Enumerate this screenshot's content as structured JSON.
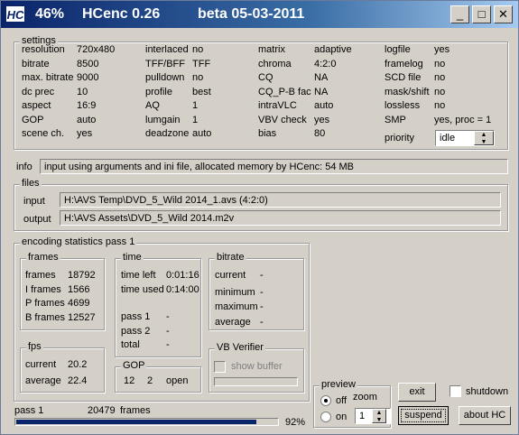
{
  "title": {
    "logo": "HC",
    "percent": "46%",
    "app": "HCenc 0.26",
    "version": "beta 05-03-2011",
    "min": "_",
    "max": "□",
    "close": "✕"
  },
  "settings": {
    "legend": "settings",
    "col1": [
      {
        "label": "resolution",
        "value": "720x480"
      },
      {
        "label": "bitrate",
        "value": "8500"
      },
      {
        "label": "max. bitrate",
        "value": "9000"
      },
      {
        "label": "dc prec",
        "value": "10"
      },
      {
        "label": "aspect",
        "value": "16:9"
      },
      {
        "label": "GOP",
        "value": "auto"
      },
      {
        "label": "scene ch.",
        "value": "yes"
      }
    ],
    "col2": [
      {
        "label": "interlaced",
        "value": "no"
      },
      {
        "label": "TFF/BFF",
        "value": "TFF"
      },
      {
        "label": "pulldown",
        "value": "no"
      },
      {
        "label": "profile",
        "value": "best"
      },
      {
        "label": "AQ",
        "value": "1"
      },
      {
        "label": "lumgain",
        "value": "1"
      },
      {
        "label": "deadzone",
        "value": "auto"
      }
    ],
    "col3": [
      {
        "label": "matrix",
        "value": "adaptive"
      },
      {
        "label": "chroma",
        "value": "4:2:0"
      },
      {
        "label": "CQ",
        "value": "NA"
      },
      {
        "label": "CQ_P-B fac",
        "value": "NA"
      },
      {
        "label": "intraVLC",
        "value": "auto"
      },
      {
        "label": "VBV check",
        "value": "yes"
      },
      {
        "label": "bias",
        "value": "80"
      }
    ],
    "col4": [
      {
        "label": "logfile",
        "value": "yes"
      },
      {
        "label": "framelog",
        "value": "no"
      },
      {
        "label": "SCD file",
        "value": "no"
      },
      {
        "label": "mask/shift",
        "value": "no"
      },
      {
        "label": "lossless",
        "value": "no"
      },
      {
        "label": "SMP",
        "value": "yes,  proc = 1"
      }
    ],
    "priority_label": "priority",
    "priority_value": "idle"
  },
  "info": {
    "label": "info",
    "text": "input using arguments and ini file,  allocated memory by HCenc:   54 MB"
  },
  "files": {
    "legend": "files",
    "input_label": "input",
    "input_value": "H:\\AVS Temp\\DVD_5_Wild 2014_1.avs   (4:2:0)",
    "output_label": "output",
    "output_value": "H:\\AVS Assets\\DVD_5_Wild 2014.m2v"
  },
  "stats": {
    "legend": "encoding statistics pass 1",
    "frames": {
      "legend": "frames",
      "rows": [
        {
          "label": "frames",
          "value": "18792"
        },
        {
          "label": "I frames",
          "value": "1566"
        },
        {
          "label": "P frames",
          "value": "4699"
        },
        {
          "label": "B frames",
          "value": "12527"
        }
      ]
    },
    "time": {
      "legend": "time",
      "rows": [
        {
          "label": "time left",
          "value": "0:01:16"
        },
        {
          "label": "time used",
          "value": "0:14:00"
        },
        {
          "label": "pass 1",
          "value": "-"
        },
        {
          "label": "pass 2",
          "value": "-"
        },
        {
          "label": "total",
          "value": "-"
        }
      ]
    },
    "bitrate": {
      "legend": "bitrate",
      "rows": [
        {
          "label": "current",
          "value": "-"
        },
        {
          "label": "minimum",
          "value": "-"
        },
        {
          "label": "maximum",
          "value": "-"
        },
        {
          "label": "average",
          "value": "-"
        }
      ]
    },
    "fps": {
      "legend": "fps",
      "rows": [
        {
          "label": "current",
          "value": "20.2"
        },
        {
          "label": "average",
          "value": "22.4"
        }
      ]
    },
    "gop": {
      "legend": "GOP",
      "v1": "12",
      "v2": "2",
      "v3": "open"
    },
    "vbv": {
      "legend": "VB Verifier",
      "show_buffer": "show buffer"
    }
  },
  "preview": {
    "legend": "preview",
    "off": "off",
    "on": "on",
    "zoom_label": "zoom",
    "zoom_value": "1"
  },
  "buttons": {
    "exit": "exit",
    "suspend": "suspend",
    "about": "about  HC",
    "shutdown": "shutdown"
  },
  "status": {
    "pass": "pass 1",
    "frames_done": "20479",
    "frames_label": "frames",
    "percent_text": "92%",
    "progress": 0.92
  },
  "colors": {
    "window_bg": "#d4d0c8",
    "title_start": "#0a246a",
    "title_end": "#a6caf0",
    "progress_fill": "#0a246a"
  }
}
